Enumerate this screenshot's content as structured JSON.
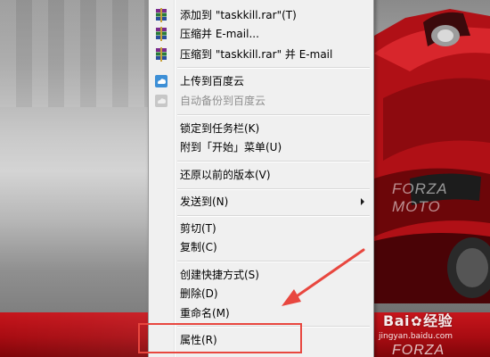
{
  "menu": {
    "items": [
      {
        "label": "添加到 \"taskkill.rar\"(T)",
        "icon": "winrar-archive-icon"
      },
      {
        "label": "压缩并 E-mail...",
        "icon": "winrar-archive-icon"
      },
      {
        "label": "压缩到 \"taskkill.rar\" 并 E-mail",
        "icon": "winrar-archive-icon"
      },
      {
        "label": "上传到百度云",
        "icon": "baidu-cloud-icon"
      },
      {
        "label": "自动备份到百度云",
        "icon": "baidu-cloud-disabled-icon",
        "disabled": true
      },
      {
        "label": "锁定到任务栏(K)"
      },
      {
        "label": "附到「开始」菜单(U)"
      },
      {
        "label": "还原以前的版本(V)"
      },
      {
        "label": "发送到(N)",
        "has_submenu": true
      },
      {
        "label": "剪切(T)"
      },
      {
        "label": "复制(C)"
      },
      {
        "label": "创建快捷方式(S)"
      },
      {
        "label": "删除(D)"
      },
      {
        "label": "重命名(M)"
      },
      {
        "label": "属性(R)"
      }
    ]
  },
  "annotation": {
    "color": "#e8473f",
    "highlighted_item": "属性(R)"
  },
  "watermark": {
    "brand": "Bai",
    "brand_paw": "✿",
    "brand_du": "经验",
    "url": "jingyan.baidu.com",
    "car_logo": "FORZA MOTO",
    "car_logo_faint": "FORZA MOTO"
  }
}
